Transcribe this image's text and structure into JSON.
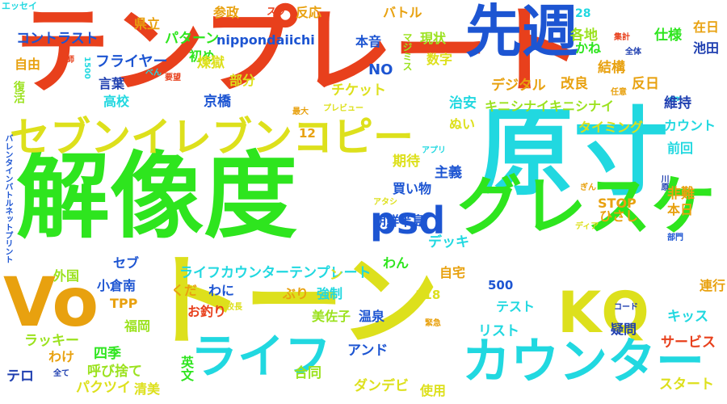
{
  "palette": {
    "red": "#e8401c",
    "orange": "#e8a10f",
    "yellow": "#dde01c",
    "lime": "#9be21e",
    "green": "#2ee51e",
    "cyan": "#21d8e0",
    "blue": "#1d55d2",
    "navy": "#1f3fb0"
  },
  "words": [
    {
      "text": "テンプレート"
    },
    {
      "text": "解像度"
    },
    {
      "text": "原寸"
    },
    {
      "text": "トーン"
    },
    {
      "text": "先週"
    },
    {
      "text": "セブンイレブンコピー"
    },
    {
      "text": "グレスケ"
    },
    {
      "text": "Vo"
    },
    {
      "text": "KQ"
    },
    {
      "text": "カウンター"
    },
    {
      "text": "ライフ"
    },
    {
      "text": "psd"
    },
    {
      "text": "エッセイ"
    },
    {
      "text": "県立"
    },
    {
      "text": "参政"
    },
    {
      "text": "スッ"
    },
    {
      "text": "反応"
    },
    {
      "text": "バトル"
    },
    {
      "text": "パターン"
    },
    {
      "text": "コントラスト"
    },
    {
      "text": "初め"
    },
    {
      "text": "nippondaiichi"
    },
    {
      "text": "マジミス"
    },
    {
      "text": "現状"
    },
    {
      "text": "28"
    },
    {
      "text": "各地"
    },
    {
      "text": "在日"
    },
    {
      "text": "仕様"
    },
    {
      "text": "池田"
    },
    {
      "text": "集計"
    },
    {
      "text": "全体"
    },
    {
      "text": "かね"
    },
    {
      "text": "本音"
    },
    {
      "text": "数字"
    },
    {
      "text": "自由"
    },
    {
      "text": "教師"
    },
    {
      "text": "フライヤー"
    },
    {
      "text": "煉獄"
    },
    {
      "text": "NO"
    },
    {
      "text": "結構"
    },
    {
      "text": "1500"
    },
    {
      "text": "べん"
    },
    {
      "text": "要望"
    },
    {
      "text": "言葉"
    },
    {
      "text": "部分"
    },
    {
      "text": "デジタル"
    },
    {
      "text": "改良"
    },
    {
      "text": "反日"
    },
    {
      "text": "任意"
    },
    {
      "text": "cm"
    },
    {
      "text": "復活"
    },
    {
      "text": "高校"
    },
    {
      "text": "チケット"
    },
    {
      "text": "治安"
    },
    {
      "text": "維持"
    },
    {
      "text": "京橋"
    },
    {
      "text": "キニシナイキニシナイ"
    },
    {
      "text": "最大"
    },
    {
      "text": "プレビュー"
    },
    {
      "text": "ぬい"
    },
    {
      "text": "カウント"
    },
    {
      "text": "タイミング"
    },
    {
      "text": "12"
    },
    {
      "text": "アプリ"
    },
    {
      "text": "期待"
    },
    {
      "text": "主義"
    },
    {
      "text": "前回"
    },
    {
      "text": "ぎん"
    },
    {
      "text": "川原"
    },
    {
      "text": "非難"
    },
    {
      "text": "STOP"
    },
    {
      "text": "本日"
    },
    {
      "text": "ひさし"
    },
    {
      "text": "アタシ"
    },
    {
      "text": "ディア"
    },
    {
      "text": "買い物"
    },
    {
      "text": "朝鮮半島"
    },
    {
      "text": "デッキ"
    },
    {
      "text": "部門"
    },
    {
      "text": "バレンタインバトルネットプリント"
    },
    {
      "text": "セブ"
    },
    {
      "text": "ライフカウンターテンプレート"
    },
    {
      "text": "わん"
    },
    {
      "text": "外国"
    },
    {
      "text": "小倉南"
    },
    {
      "text": "わに"
    },
    {
      "text": "500"
    },
    {
      "text": "自宅"
    },
    {
      "text": "連行"
    },
    {
      "text": "くだ"
    },
    {
      "text": "ぶり"
    },
    {
      "text": "118"
    },
    {
      "text": "TPP"
    },
    {
      "text": "校長"
    },
    {
      "text": "強制"
    },
    {
      "text": "テスト"
    },
    {
      "text": "コード"
    },
    {
      "text": "お釣り"
    },
    {
      "text": "キッス"
    },
    {
      "text": "福岡"
    },
    {
      "text": "美佐子"
    },
    {
      "text": "温泉"
    },
    {
      "text": "リスト"
    },
    {
      "text": "緊急"
    },
    {
      "text": "ラッキー"
    },
    {
      "text": "疑問"
    },
    {
      "text": "四季"
    },
    {
      "text": "アンド"
    },
    {
      "text": "サービス"
    },
    {
      "text": "わけ"
    },
    {
      "text": "英文"
    },
    {
      "text": "テロ"
    },
    {
      "text": "呼び捨て"
    },
    {
      "text": "合同"
    },
    {
      "text": "全て"
    },
    {
      "text": "パクツイ"
    },
    {
      "text": "清美"
    },
    {
      "text": "ダンデビ"
    },
    {
      "text": "使用"
    },
    {
      "text": "スタート"
    },
    {
      "text": "ン"
    }
  ]
}
